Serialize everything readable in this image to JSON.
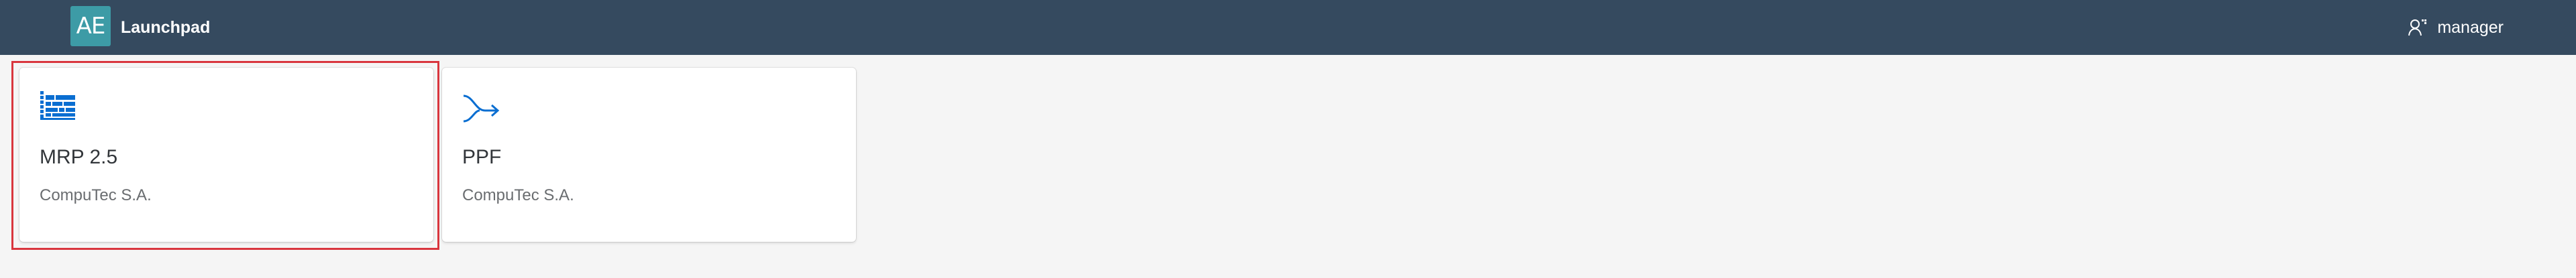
{
  "shellbar": {
    "logo_text": "AE",
    "title": "Launchpad",
    "user_name": "manager"
  },
  "tiles": [
    {
      "title": "MRP 2.5",
      "subtitle": "CompuTec S.A.",
      "icon": "list-grid-icon",
      "selected": true
    },
    {
      "title": "PPF",
      "subtitle": "CompuTec S.A.",
      "icon": "process-flow-icon",
      "selected": false
    }
  ],
  "colors": {
    "shellbar": "#354a5f",
    "logo": "#3d9ba6",
    "icon": "#0a6ed1",
    "page_background": "#f5f5f5",
    "highlight": "#d9363e"
  }
}
